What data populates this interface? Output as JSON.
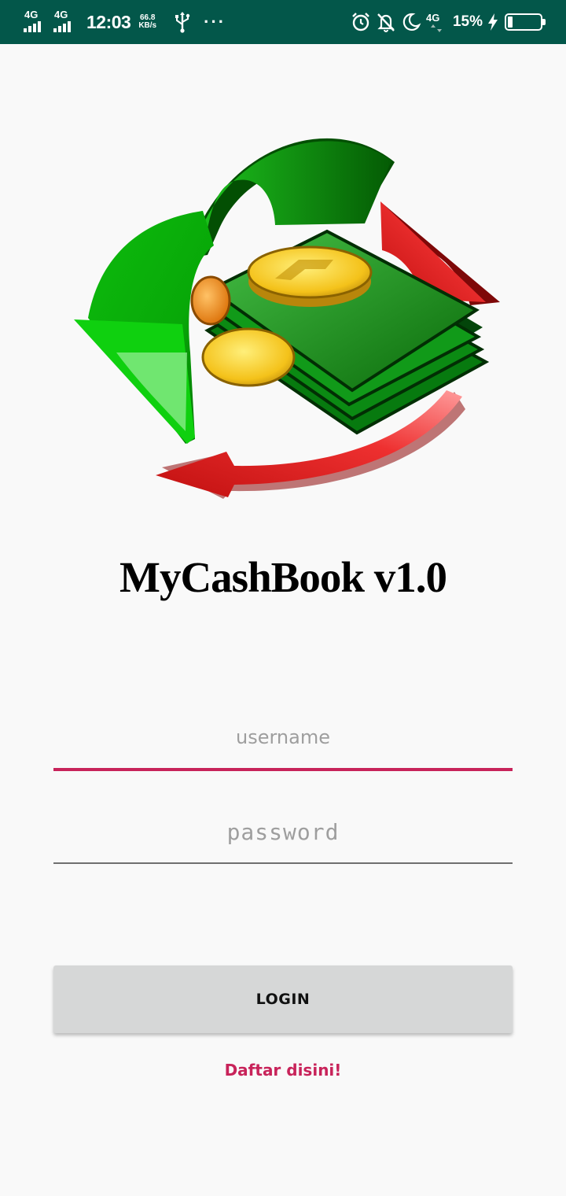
{
  "status_bar": {
    "signal_1_label": "4G",
    "signal_2_label": "4G",
    "time": "12:03",
    "net_speed_value": "66.8",
    "net_speed_unit": "KB/s",
    "more_indicator": "···",
    "network_type": "4G",
    "battery_percent": "15%",
    "battery_level": 0.15,
    "icons": [
      "usb-icon",
      "alarm-icon",
      "notifications-off-icon",
      "moon-icon",
      "charging-bolt-icon",
      "battery-icon"
    ]
  },
  "app": {
    "title": "MyCashBook v1.0",
    "logo_icon": "cashbook-logo-icon"
  },
  "login_form": {
    "username_placeholder": "username",
    "username_value": "",
    "password_placeholder": "password",
    "password_value": "",
    "login_label": "LOGIN",
    "register_link": "Daftar disini!"
  },
  "colors": {
    "status_bar": "#03574a",
    "accent": "#c8235a",
    "button": "#d6d7d7",
    "background": "#f9f9f9"
  }
}
